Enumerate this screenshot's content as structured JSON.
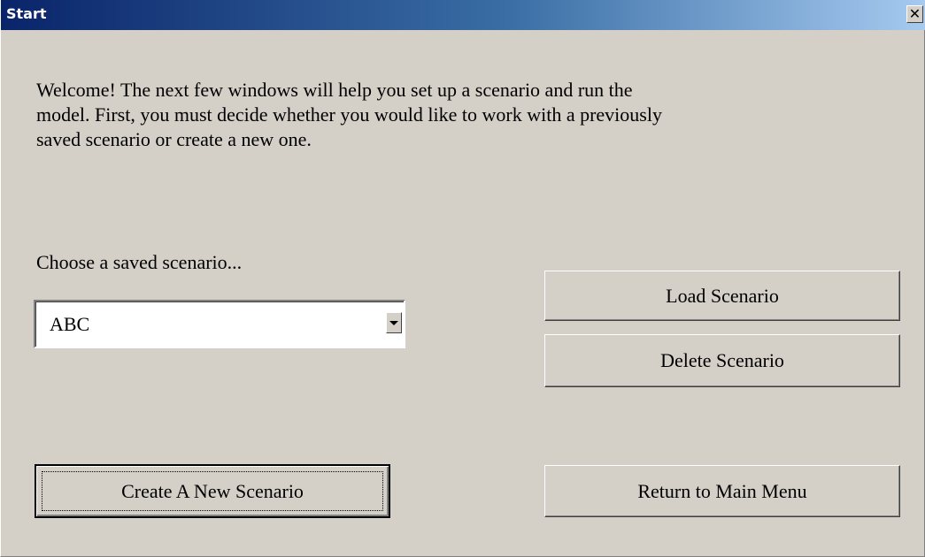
{
  "window": {
    "title": "Start",
    "close_glyph": "✕"
  },
  "welcome_text": "Welcome! The next few windows will help you set up a scenario and run the\nmodel.  First, you must decide whether you would like to work with a previously\nsaved scenario or create a new one.",
  "scenario_picker": {
    "label": "Choose a saved scenario...",
    "selected_value": "ABC"
  },
  "buttons": {
    "load": "Load Scenario",
    "delete": "Delete Scenario",
    "create": "Create A New Scenario",
    "return": "Return to Main Menu"
  },
  "colors": {
    "title_gradient_start": "#0a246a",
    "title_gradient_end": "#a6caf0",
    "face": "#d4d0c8"
  }
}
